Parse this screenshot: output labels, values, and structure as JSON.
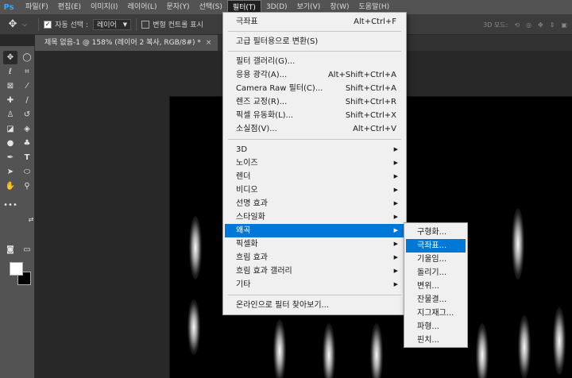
{
  "app": {
    "logo": "Ps"
  },
  "menubar": [
    {
      "label": "파일(F)"
    },
    {
      "label": "편집(E)"
    },
    {
      "label": "이미지(I)"
    },
    {
      "label": "레이어(L)"
    },
    {
      "label": "문자(Y)"
    },
    {
      "label": "선택(S)"
    },
    {
      "label": "필터(T)"
    },
    {
      "label": "3D(D)"
    },
    {
      "label": "보기(V)"
    },
    {
      "label": "창(W)"
    },
    {
      "label": "도움말(H)"
    }
  ],
  "options": {
    "auto_select_label": "자동 선택 :",
    "auto_select_value": "레이어",
    "transform_label": "변형 컨트롤 표시",
    "mode_3d_label": "3D 모드:"
  },
  "tab": {
    "title": "제목 없음-1 @ 158% (레이어 2 복사, RGB/8#) *",
    "close": "×"
  },
  "filter_menu": {
    "items": [
      {
        "label": "극좌표",
        "shortcut": "Alt+Ctrl+F"
      },
      {
        "label": "고급 필터용으로 변환(S)",
        "shortcut": ""
      },
      {
        "label": "필터 갤러리(G)...",
        "shortcut": ""
      },
      {
        "label": "응용 광각(A)...",
        "shortcut": "Alt+Shift+Ctrl+A"
      },
      {
        "label": "Camera Raw 필터(C)...",
        "shortcut": "Shift+Ctrl+A"
      },
      {
        "label": "렌즈 교정(R)...",
        "shortcut": "Shift+Ctrl+R"
      },
      {
        "label": "픽셀 유동화(L)...",
        "shortcut": "Shift+Ctrl+X"
      },
      {
        "label": "소실점(V)...",
        "shortcut": "Alt+Ctrl+V"
      },
      {
        "label": "3D",
        "shortcut": ""
      },
      {
        "label": "노이즈",
        "shortcut": ""
      },
      {
        "label": "렌더",
        "shortcut": ""
      },
      {
        "label": "비디오",
        "shortcut": ""
      },
      {
        "label": "선명 효과",
        "shortcut": ""
      },
      {
        "label": "스타일화",
        "shortcut": ""
      },
      {
        "label": "왜곡",
        "shortcut": ""
      },
      {
        "label": "픽셀화",
        "shortcut": ""
      },
      {
        "label": "흐림 효과",
        "shortcut": ""
      },
      {
        "label": "흐림 효과 갤러리",
        "shortcut": ""
      },
      {
        "label": "기타",
        "shortcut": ""
      },
      {
        "label": "온라인으로 필터 찾아보기...",
        "shortcut": ""
      }
    ],
    "submenu_arrow": "▶"
  },
  "distort_submenu": {
    "items": [
      {
        "label": "구형화..."
      },
      {
        "label": "극좌표..."
      },
      {
        "label": "기울임..."
      },
      {
        "label": "돌리기..."
      },
      {
        "label": "변위..."
      },
      {
        "label": "잔물결..."
      },
      {
        "label": "지그재그..."
      },
      {
        "label": "파형..."
      },
      {
        "label": "핀치..."
      }
    ]
  },
  "colors": {
    "accent": "#0078d7",
    "foreground_swatch": "#ffffff",
    "background_swatch": "#000000"
  }
}
